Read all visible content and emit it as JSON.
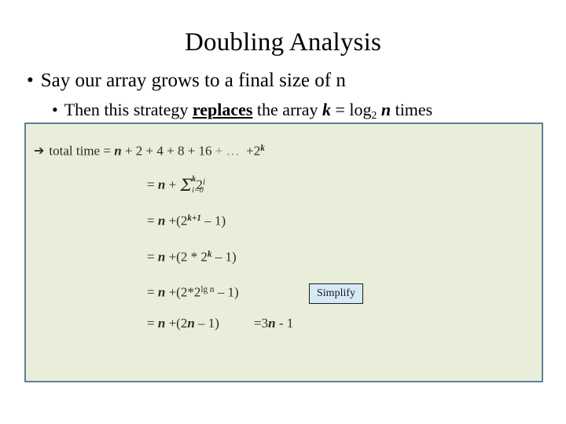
{
  "slide": {
    "title": "Doubling Analysis",
    "bullet_glyph": "•",
    "arrow_glyph": "➔",
    "bullets": [
      {
        "level": 1,
        "parts": [
          {
            "text": "Say our array grows to a final size of n",
            "style": "plain"
          }
        ]
      },
      {
        "level": 2,
        "parts": [
          {
            "text": "Then this strategy ",
            "style": "plain"
          },
          {
            "text": "replaces",
            "style": "bold-underline"
          },
          {
            "text": " the array ",
            "style": "plain"
          },
          {
            "text": "k",
            "style": "bold-italic"
          },
          {
            "text": " = log",
            "style": "plain"
          },
          {
            "text": "2",
            "style": "subscript"
          },
          {
            "text": " ",
            "style": "plain"
          },
          {
            "text": "n",
            "style": "bold-italic"
          },
          {
            "text": " times",
            "style": "plain"
          }
        ]
      }
    ]
  },
  "panel": {
    "background_color": "#e9eeda",
    "border_color": "#5f7f97",
    "lines": [
      {
        "id": "total-time",
        "label": "total time",
        "text": "➔ total time = n + 2 + 4 + 8 + 16 + …  + 2k",
        "lead": "total time",
        "equals": "=",
        "terms": [
          "n",
          "2",
          "4",
          "8",
          "16",
          "…",
          "2"
        ],
        "exponent": "k"
      },
      {
        "id": "sum-form",
        "text": "= n + Σ i=0 to k of 2^i",
        "equals": "=",
        "var": "n",
        "plus": "+",
        "sigma": "Σ",
        "sigma_top": "k",
        "sigma_bottom": "i=0",
        "base": "2",
        "exponent": "i"
      },
      {
        "id": "pow-k-plus-1",
        "text": "= n + (2k+1 – 1)",
        "equals": "=",
        "var": "n",
        "plus": "+",
        "open": "(",
        "base": "2",
        "exponent": "k+1",
        "minus": "– 1",
        "close": ")"
      },
      {
        "id": "two-times-pow-k",
        "text": "= n + (2 * 2k – 1)",
        "equals": "=",
        "var": "n",
        "plus": "+",
        "open": "(",
        "factor": "2 * 2",
        "exponent": "k",
        "minus": "– 1",
        "close": ")"
      },
      {
        "id": "two-times-pow-lg-n",
        "text": "= n + (2*2lg n – 1)",
        "equals": "=",
        "var": "n",
        "plus": "+",
        "open": "(",
        "factor": "2*2",
        "exponent": "lg n",
        "minus": "– 1",
        "close": ")"
      },
      {
        "id": "two-n-minus-one",
        "text": "= n + (2n – 1)",
        "equals": "=",
        "var": "n",
        "plus": "+",
        "open": "(",
        "coef": "2",
        "var2": "n",
        "minus": "– 1",
        "close": ")"
      },
      {
        "id": "result",
        "text": "= 3n - 1",
        "equals": "=",
        "coef": "3",
        "var": "n",
        "tail": "- 1"
      }
    ],
    "callout": {
      "label": "Simplify",
      "fill_color": "#d6e9f6",
      "border_color": "#1d1d1d"
    }
  }
}
